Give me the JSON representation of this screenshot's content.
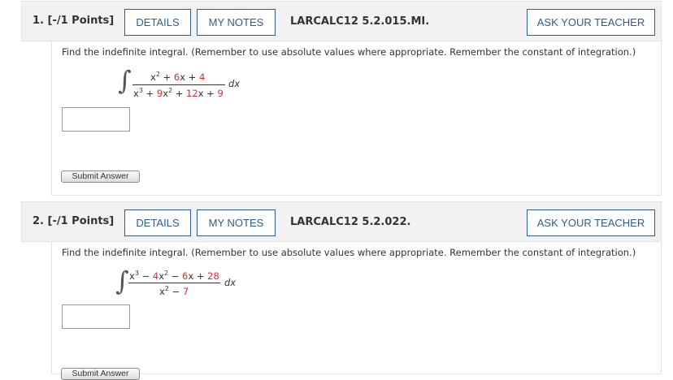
{
  "questions": [
    {
      "number_label": "1.",
      "points_label": "[-/1 Points]",
      "details_label": "DETAILS",
      "notes_label": "MY NOTES",
      "reference": "LARCALC12 5.2.015.MI.",
      "ask_label": "ASK YOUR TEACHER",
      "instruction": "Find the indefinite integral. (Remember to use absolute values where appropriate. Remember the constant of integration.)",
      "integral_symbol": "∫",
      "dx": "dx",
      "answer_value": "",
      "submit_label": "Submit Answer"
    },
    {
      "number_label": "2.",
      "points_label": "[-/1 Points]",
      "details_label": "DETAILS",
      "notes_label": "MY NOTES",
      "reference": "LARCALC12 5.2.022.",
      "ask_label": "ASK YOUR TEACHER",
      "instruction": "Find the indefinite integral. (Remember to use absolute values where appropriate. Remember the constant of integration.)",
      "integral_symbol": "∫",
      "dx": "dx",
      "answer_value": "",
      "submit_label": "Submit Answer"
    }
  ],
  "colors": {
    "button_border": "#2f5d8a",
    "header_bg": "#f2f2f2",
    "coefficient_red": "#d32f2f"
  }
}
